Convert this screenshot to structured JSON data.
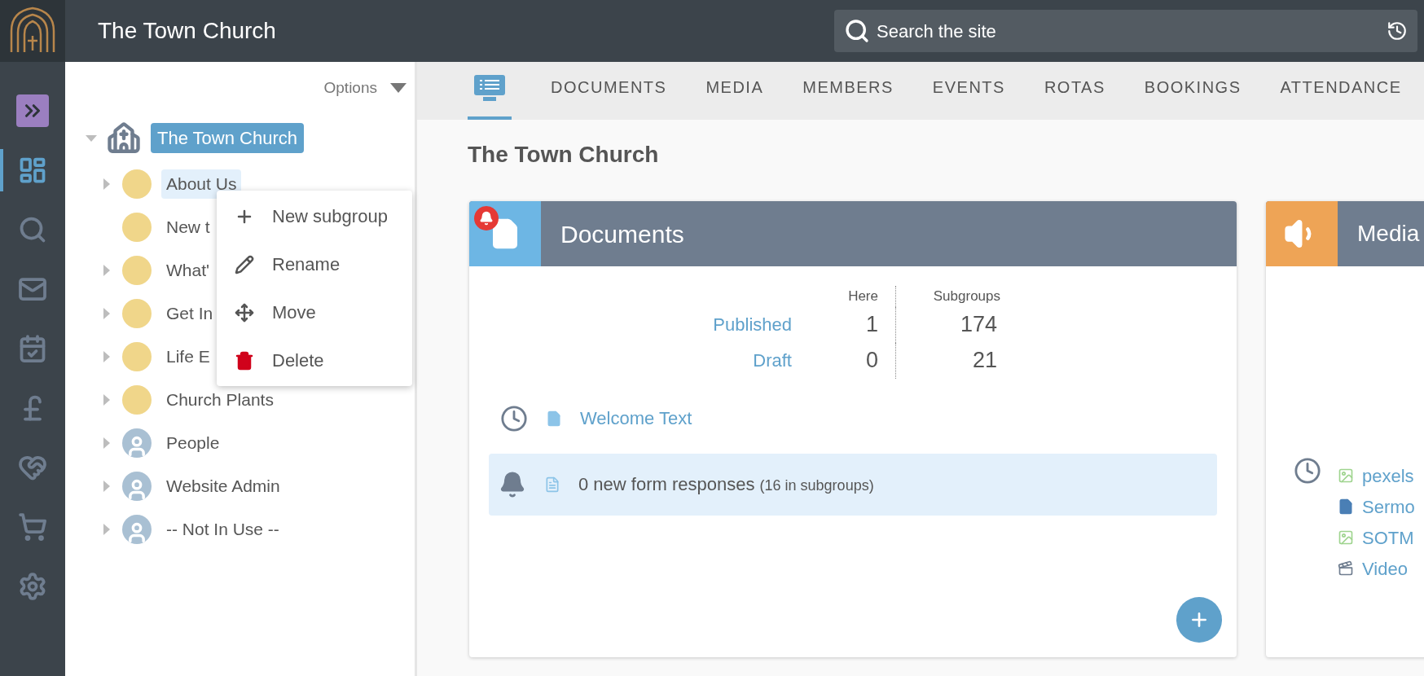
{
  "header": {
    "title": "The Town Church",
    "search": {
      "placeholder": "Search the site"
    }
  },
  "rail": [
    {
      "kind": "expand",
      "selected": false
    },
    {
      "kind": "dashboard",
      "selected": true
    },
    {
      "kind": "search",
      "selected": false
    },
    {
      "kind": "mail",
      "selected": false
    },
    {
      "kind": "calendar",
      "selected": false
    },
    {
      "kind": "finance",
      "selected": false
    },
    {
      "kind": "giving",
      "selected": false
    },
    {
      "kind": "shop",
      "selected": false
    },
    {
      "kind": "settings",
      "selected": false
    }
  ],
  "tree": {
    "options": "Options",
    "root": {
      "label": "The Town Church",
      "selected": true,
      "expanded": true,
      "children": [
        {
          "label": "About Us",
          "kind": "group",
          "has_children": true,
          "highlighted": true
        },
        {
          "label": "New t",
          "kind": "group",
          "has_children": false,
          "highlighted": false
        },
        {
          "label": "What'",
          "kind": "group",
          "has_children": true,
          "highlighted": false
        },
        {
          "label": "Get In",
          "kind": "group",
          "has_children": true,
          "highlighted": false
        },
        {
          "label": "Life E",
          "kind": "group",
          "has_children": true,
          "highlighted": false
        },
        {
          "label": "Church Plants",
          "kind": "group",
          "has_children": true,
          "highlighted": false
        },
        {
          "label": "People",
          "kind": "person",
          "has_children": true,
          "highlighted": false
        },
        {
          "label": "Website Admin",
          "kind": "person",
          "has_children": true,
          "highlighted": false
        },
        {
          "label": "-- Not In Use --",
          "kind": "person",
          "has_children": true,
          "highlighted": false
        }
      ]
    }
  },
  "context_menu": [
    {
      "kind": "add",
      "label": "New subgroup"
    },
    {
      "kind": "rename",
      "label": "Rename"
    },
    {
      "kind": "move",
      "label": "Move"
    },
    {
      "kind": "delete",
      "label": "Delete"
    }
  ],
  "tabs": [
    {
      "kind": "icon",
      "selected": true
    },
    {
      "kind": "text",
      "label": "DOCUMENTS",
      "selected": false
    },
    {
      "kind": "text",
      "label": "MEDIA",
      "selected": false
    },
    {
      "kind": "text",
      "label": "MEMBERS",
      "selected": false
    },
    {
      "kind": "text",
      "label": "EVENTS",
      "selected": false
    },
    {
      "kind": "text",
      "label": "ROTAS",
      "selected": false
    },
    {
      "kind": "text",
      "label": "BOOKINGS",
      "selected": false
    },
    {
      "kind": "text",
      "label": "ATTENDANCE",
      "selected": false
    }
  ],
  "page_title": "The Town Church",
  "documents": {
    "title": "Documents",
    "alert": true,
    "columns": [
      "Here",
      "Subgroups"
    ],
    "rows": [
      {
        "label": "Published",
        "here": "1",
        "subgroups": "174"
      },
      {
        "label": "Draft",
        "here": "0",
        "subgroups": "21"
      }
    ],
    "recent": [
      {
        "label": "Welcome Text"
      }
    ],
    "notice": {
      "text": "0 new form responses",
      "detail": "(16 in subgroups)"
    }
  },
  "media": {
    "title": "Media",
    "recent": [
      {
        "kind": "image",
        "label": "pexels"
      },
      {
        "kind": "document",
        "label": "Sermo"
      },
      {
        "kind": "image",
        "label": "SOTM"
      },
      {
        "kind": "video",
        "label": "Video"
      }
    ]
  }
}
